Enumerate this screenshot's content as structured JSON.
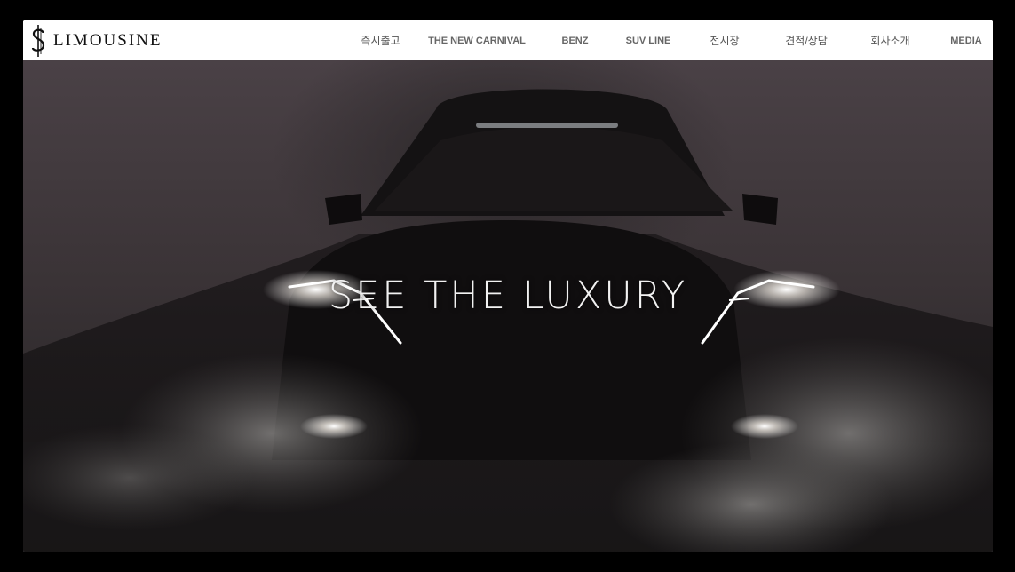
{
  "brand": {
    "logo_text": "LIMOUSINE",
    "logo_icon": "dollar-s-monogram-icon"
  },
  "nav": {
    "items": [
      {
        "label": "즉시출고"
      },
      {
        "label": "THE NEW CARNIVAL"
      },
      {
        "label": "BENZ"
      },
      {
        "label": "SUV LINE"
      },
      {
        "label": "전시장"
      },
      {
        "label": "견적/상담"
      },
      {
        "label": "회사소개"
      },
      {
        "label": "MEDIA"
      }
    ]
  },
  "hero": {
    "tagline": "SEE THE LUXURY",
    "background_image": "dark-car-with-headlights-and-smoke"
  },
  "colors": {
    "navbar_bg": "#ffffff",
    "nav_text": "#666666",
    "hero_text": "#f2f2f2"
  }
}
